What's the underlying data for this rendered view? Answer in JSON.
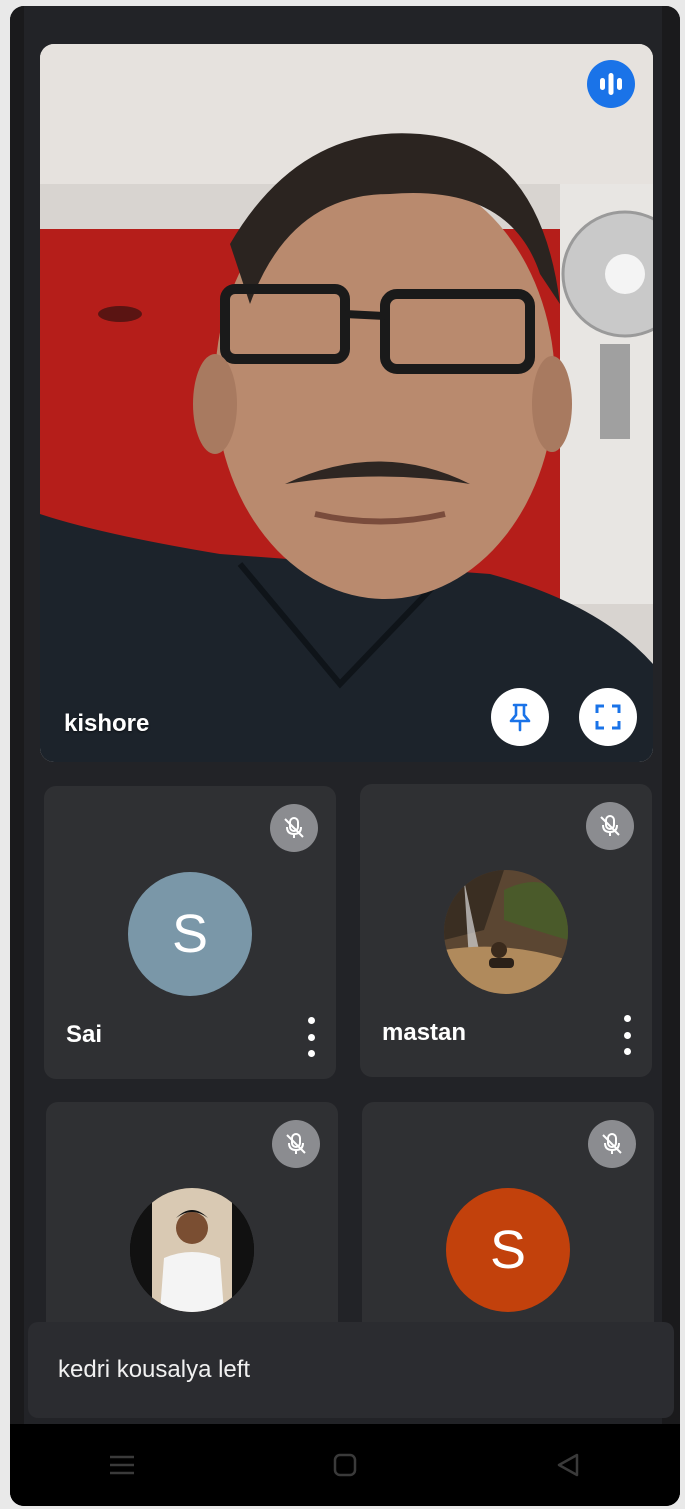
{
  "main_speaker": {
    "name": "kishore",
    "icons": {
      "speaking": "speaking-indicator-icon",
      "pin": "pin-icon",
      "fullscreen": "fullscreen-icon"
    },
    "accent": "#1a73e8"
  },
  "participants": [
    {
      "name": "Sai",
      "initial": "S",
      "avatar_color": "#7a97a8",
      "muted": true,
      "has_menu": true
    },
    {
      "name": "mastan",
      "initial": "",
      "avatar_color": "#6b5a44",
      "muted": true,
      "has_menu": true
    },
    {
      "name": "",
      "initial": "",
      "avatar_color": "#ffffff",
      "muted": true,
      "has_menu": false
    },
    {
      "name": "",
      "initial": "S",
      "avatar_color": "#c2410c",
      "muted": true,
      "has_menu": false
    }
  ],
  "toast": {
    "message": "kedri kousalya left"
  },
  "navbar": {
    "icons": [
      "menu-icon",
      "home-icon",
      "back-icon"
    ]
  }
}
